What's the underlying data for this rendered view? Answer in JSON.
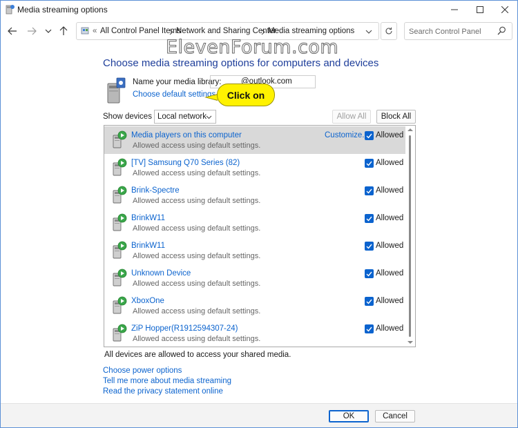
{
  "window": {
    "title": "Media streaming options"
  },
  "nav": {
    "breadcrumb": [
      "All Control Panel Items",
      "Network and Sharing Center",
      "Media streaming options"
    ],
    "overflow": "«",
    "search_placeholder": "Search Control Panel"
  },
  "watermark": "ElevenForum.com",
  "main": {
    "heading": "Choose media streaming options for computers and devices",
    "library_label": "Name your media library:",
    "library_value": "@outlook.com",
    "default_settings_link": "Choose default settings...",
    "callout": "Click on",
    "show_devices_label": "Show devices on:",
    "show_devices_value": "Local network",
    "allow_all": "Allow All",
    "block_all": "Block All",
    "customize_link": "Customize...",
    "devices": [
      {
        "name": "Media players on this computer",
        "sub": "Allowed access using default settings.",
        "state": "Allowed",
        "checked": true,
        "selected": true
      },
      {
        "name": "[TV] Samsung Q70 Series (82)",
        "sub": "Allowed access using default settings.",
        "state": "Allowed",
        "checked": true
      },
      {
        "name": "Brink-Spectre",
        "sub": "Allowed access using default settings.",
        "state": "Allowed",
        "checked": true
      },
      {
        "name": "BrinkW11",
        "sub": "Allowed access using default settings.",
        "state": "Allowed",
        "checked": true
      },
      {
        "name": "BrinkW11",
        "sub": "Allowed access using default settings.",
        "state": "Allowed",
        "checked": true
      },
      {
        "name": "Unknown Device",
        "sub": "Allowed access using default settings.",
        "state": "Allowed",
        "checked": true
      },
      {
        "name": "XboxOne",
        "sub": "Allowed access using default settings.",
        "state": "Allowed",
        "checked": true
      },
      {
        "name": "ZiP Hopper(R1912594307-24)",
        "sub": "Allowed access using default settings.",
        "state": "Allowed",
        "checked": true
      }
    ],
    "status": "All devices are allowed to access your shared media.",
    "links": [
      "Choose power options",
      "Tell me more about media streaming",
      "Read the privacy statement online"
    ]
  },
  "footer": {
    "ok": "OK",
    "cancel": "Cancel"
  },
  "colors": {
    "accent": "#0b63ce",
    "heading": "#1e3e9a",
    "callout": "#fff200",
    "selected_row": "#d9d9d9"
  }
}
